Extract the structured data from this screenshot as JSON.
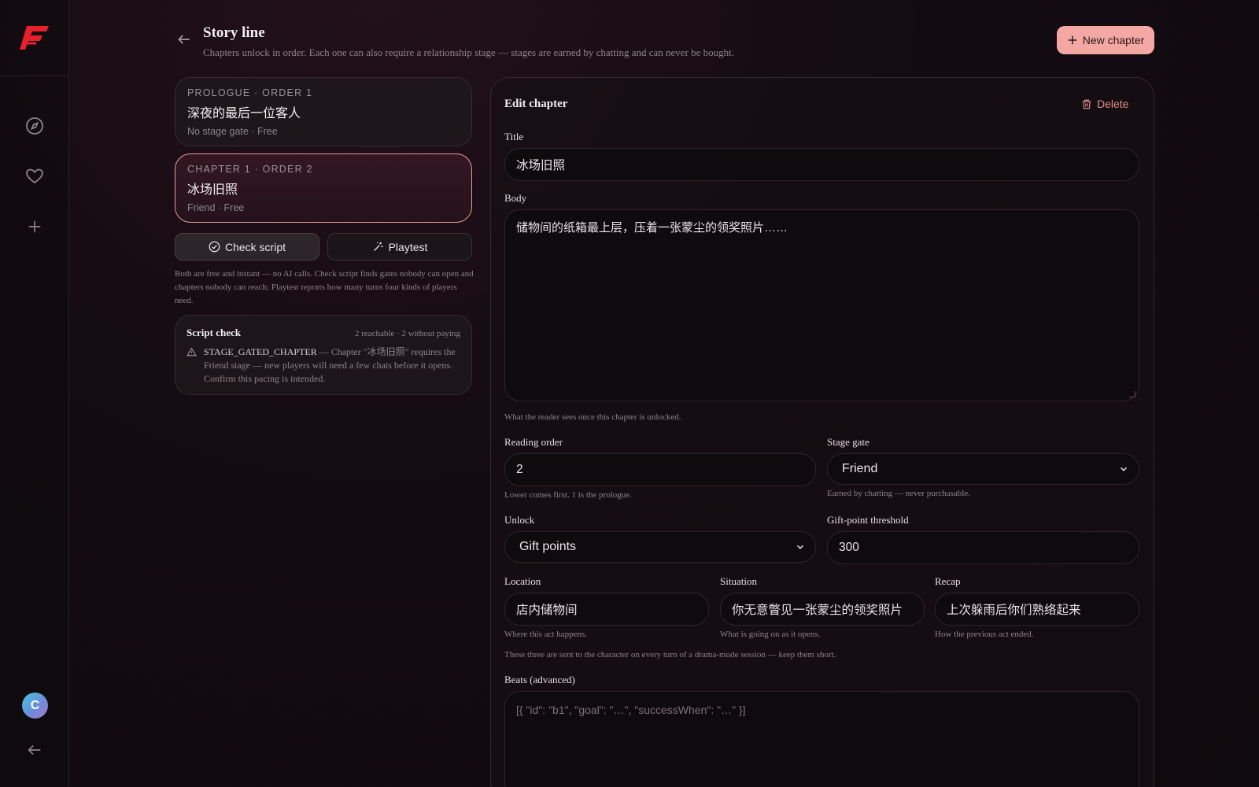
{
  "sidebar": {
    "logo": "app-logo",
    "nav": [
      {
        "icon": "compass-icon"
      },
      {
        "icon": "heart-icon"
      },
      {
        "icon": "plus-icon"
      }
    ],
    "avatar_initial": "C",
    "collapse_icon": "arrow-left-icon"
  },
  "header": {
    "title": "Story line",
    "subtitle": "Chapters unlock in order. Each one can also require a relationship stage — stages are earned by chatting and can never be bought.",
    "new_chapter_label": "New chapter"
  },
  "chapters": [
    {
      "meta": "PROLOGUE · ORDER 1",
      "title": "深夜的最后一位客人",
      "sub": "No stage gate · Free",
      "active": false
    },
    {
      "meta": "CHAPTER 1 · ORDER 2",
      "title": "冰场旧照",
      "sub": "Friend · Free",
      "active": true
    }
  ],
  "tools": {
    "check_label": "Check script",
    "playtest_label": "Playtest",
    "help": "Both are free and instant — no AI calls. Check script finds gates nobody can open and chapters nobody can reach; Playtest reports how many turns four kinds of players need."
  },
  "script_check": {
    "title": "Script check",
    "stats": "2 reachable · 2 without paying",
    "issue_code": "STAGE_GATED_CHAPTER",
    "issue_text": " — Chapter \"冰场旧照\" requires the Friend stage — new players will need a few chats before it opens. Confirm this pacing is intended."
  },
  "editor": {
    "heading": "Edit chapter",
    "delete_label": "Delete",
    "title_label": "Title",
    "title_value": "冰场旧照",
    "body_label": "Body",
    "body_value": "储物间的纸箱最上层，压着一张蒙尘的领奖照片……",
    "body_hint": "What the reader sees once this chapter is unlocked.",
    "order_label": "Reading order",
    "order_value": "2",
    "order_hint": "Lower comes first. 1 is the prologue.",
    "stage_label": "Stage gate",
    "stage_value": "Friend",
    "stage_hint": "Earned by chatting — never purchasable.",
    "unlock_label": "Unlock",
    "unlock_value": "Gift points",
    "threshold_label": "Gift-point threshold",
    "threshold_value": "300",
    "location_label": "Location",
    "location_value": "店内储物间",
    "location_hint": "Where this act happens.",
    "situation_label": "Situation",
    "situation_value": "你无意瞥见一张蒙尘的领奖照片",
    "situation_hint": "What is going on as it opens.",
    "recap_label": "Recap",
    "recap_value": "上次躲雨后你们熟络起来",
    "recap_hint": "How the previous act ended.",
    "three_hint": "These three are sent to the character on every turn of a drama-mode session — keep them short.",
    "beats_label": "Beats (advanced)",
    "beats_placeholder": "[{ \"id\": \"b1\", \"goal\": \"…\", \"successWhen\": \"…\" }]"
  },
  "colors": {
    "accent": "#f4a8a4",
    "danger": "#e88c88",
    "active_border": "#e89b9b"
  }
}
